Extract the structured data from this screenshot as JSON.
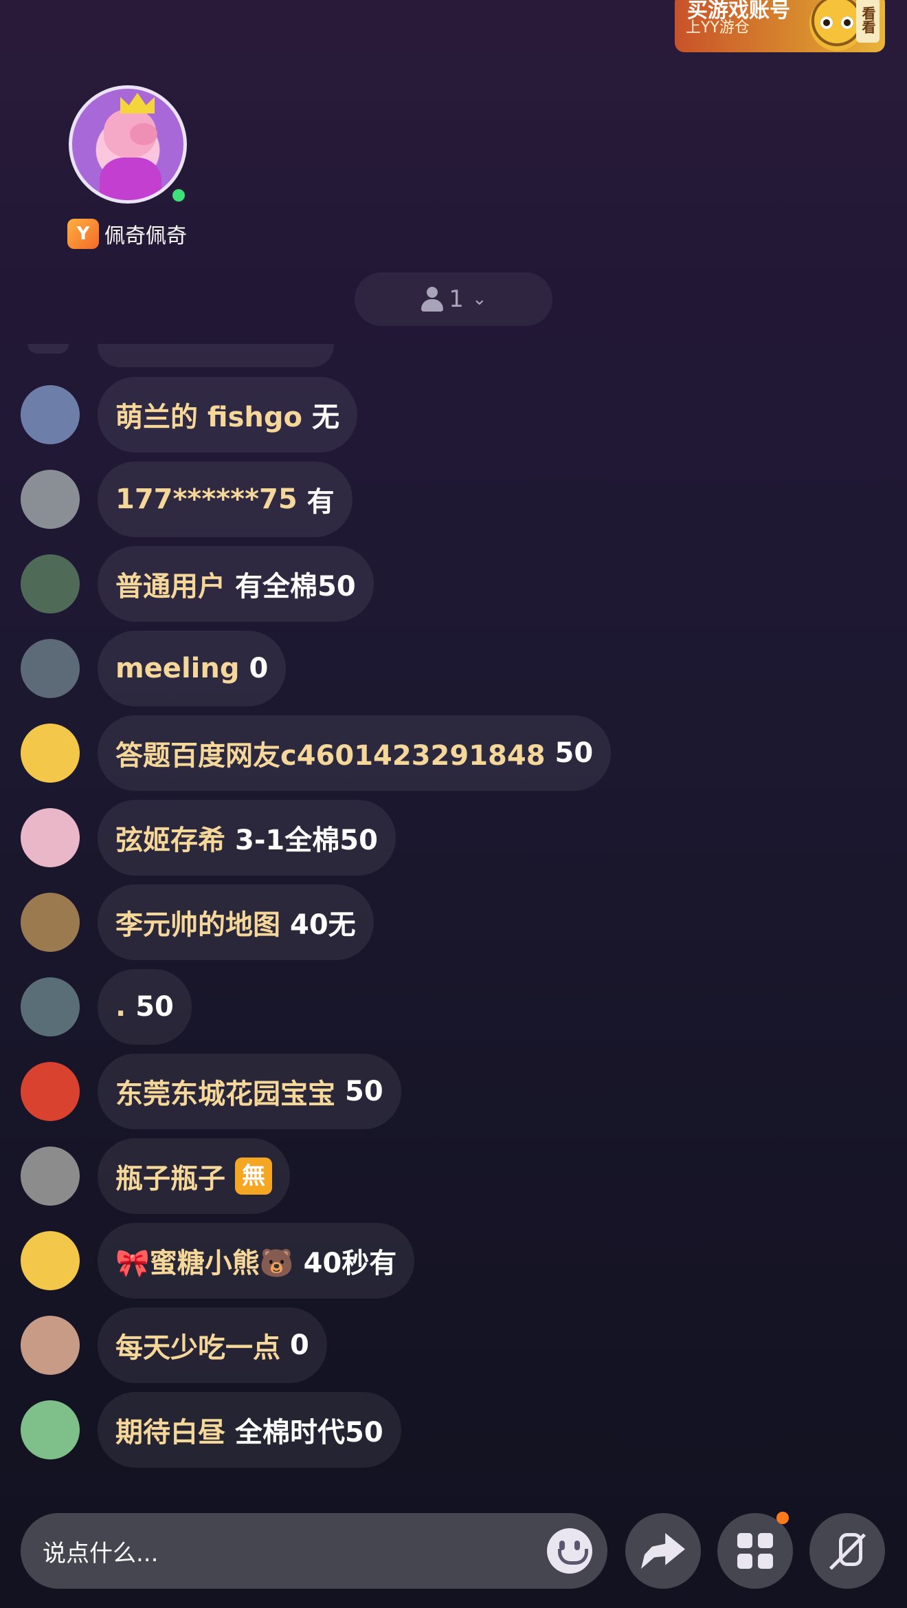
{
  "promo": {
    "title": "买游戏账号",
    "subtitle": "上YY游仓",
    "badge": "看看"
  },
  "host": {
    "name": "佩奇佩奇",
    "badge_icon": "host-badge-icon"
  },
  "member_count": "1",
  "chat": [
    {
      "user": "萌兰的 fishgo",
      "msg": "无",
      "avatar_color": "#6d7fa8"
    },
    {
      "user": "177******75",
      "msg": "有",
      "avatar_color": "#8a8f96"
    },
    {
      "user": "普通用户",
      "msg": "有全棉50",
      "avatar_color": "#4f6a56"
    },
    {
      "user": "meeling",
      "msg": "0",
      "avatar_color": "#5d6a78"
    },
    {
      "user": "答题百度网友c4601423291848",
      "msg": "50",
      "avatar_color": "#f3c84a"
    },
    {
      "user": "弦姬存希",
      "msg": "3-1全棉50",
      "avatar_color": "#e9b7c7"
    },
    {
      "user": "李元帅的地图",
      "msg": "40无",
      "avatar_color": "#9a7a4e"
    },
    {
      "user": ".",
      "msg": "50",
      "avatar_color": "#5a6e78"
    },
    {
      "user": "东莞东城花园宝宝",
      "msg": "50",
      "avatar_color": "#d9422e"
    },
    {
      "user": "瓶子瓶子",
      "msg": "",
      "emoji": "無",
      "avatar_color": "#8c8c8c"
    },
    {
      "user": "🎀蜜糖小熊🐻",
      "msg": "40秒有",
      "avatar_color": "#f3c84a"
    },
    {
      "user": "每天少吃一点",
      "msg": "0",
      "avatar_color": "#c79b86"
    },
    {
      "user": "期待白昼",
      "msg": "全棉时代50",
      "avatar_color": "#7fc08a"
    }
  ],
  "input": {
    "placeholder": "说点什么..."
  },
  "colors": {
    "username": "#f6d79a",
    "notif_dot": "#ff7a1a",
    "online": "#3ee07a"
  }
}
